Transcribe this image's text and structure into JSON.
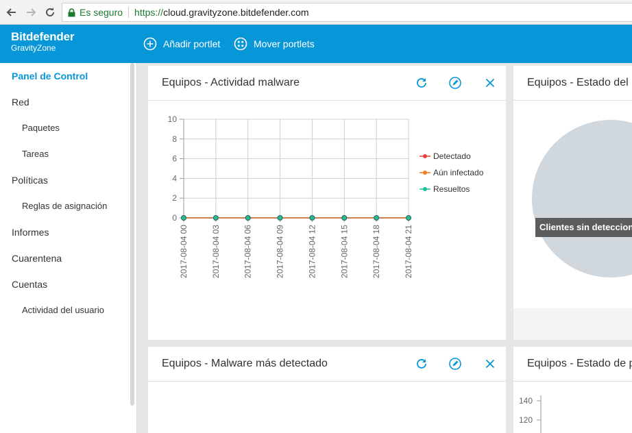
{
  "browser": {
    "secure_label": "Es seguro",
    "url_scheme": "https://",
    "url_rest": "cloud.gravityzone.bitdefender.com"
  },
  "header": {
    "logo_main": "Bitdefender",
    "logo_sub": "GravityZone",
    "add_portlet": "Añadir portlet",
    "move_portlets": "Mover portlets",
    "brand_color": "#0797d8"
  },
  "sidebar": {
    "items": [
      {
        "label": "Panel de Control"
      },
      {
        "label": "Red"
      },
      {
        "label": "Paquetes"
      },
      {
        "label": "Tareas"
      },
      {
        "label": "Políticas"
      },
      {
        "label": "Reglas de asignación"
      },
      {
        "label": "Informes"
      },
      {
        "label": "Cuarentena"
      },
      {
        "label": "Cuentas"
      },
      {
        "label": "Actividad del usuario"
      }
    ]
  },
  "portlets": {
    "malware_activity": {
      "title": "Equipos - Actividad malware",
      "legend": [
        "Detectado",
        "Aún infectado",
        "Resueltos"
      ]
    },
    "status": {
      "title": "Equipos - Estado del r",
      "tooltip": "Clientes sin deteccione"
    },
    "top_malware": {
      "title": "Equipos - Malware más detectado"
    },
    "protection_status": {
      "title": "Equipos - Estado de p"
    }
  },
  "chart_data": [
    {
      "type": "line",
      "categories": [
        "2017-08-04 00",
        "2017-08-04 03",
        "2017-08-04 06",
        "2017-08-04 09",
        "2017-08-04 12",
        "2017-08-04 15",
        "2017-08-04 18",
        "2017-08-04 21"
      ],
      "series": [
        {
          "name": "Detectado",
          "color": "#e8433b",
          "values": [
            0,
            0,
            0,
            0,
            0,
            0,
            0,
            0
          ]
        },
        {
          "name": "Aún infectado",
          "color": "#f47a1f",
          "values": [
            0,
            0,
            0,
            0,
            0,
            0,
            0,
            0
          ]
        },
        {
          "name": "Resueltos",
          "color": "#1cbf96",
          "values": [
            0,
            0,
            0,
            0,
            0,
            0,
            0,
            0
          ]
        }
      ],
      "yticks": [
        0,
        2,
        4,
        6,
        8,
        10
      ],
      "ylim": [
        0,
        10
      ],
      "grid": true,
      "legend": "right"
    },
    {
      "type": "pie",
      "slices": [
        {
          "label": "Clientes sin deteccione",
          "value": 100,
          "color": "#d0d8de"
        }
      ]
    },
    {
      "type": "bar",
      "yticks": [
        120,
        140
      ]
    }
  ]
}
